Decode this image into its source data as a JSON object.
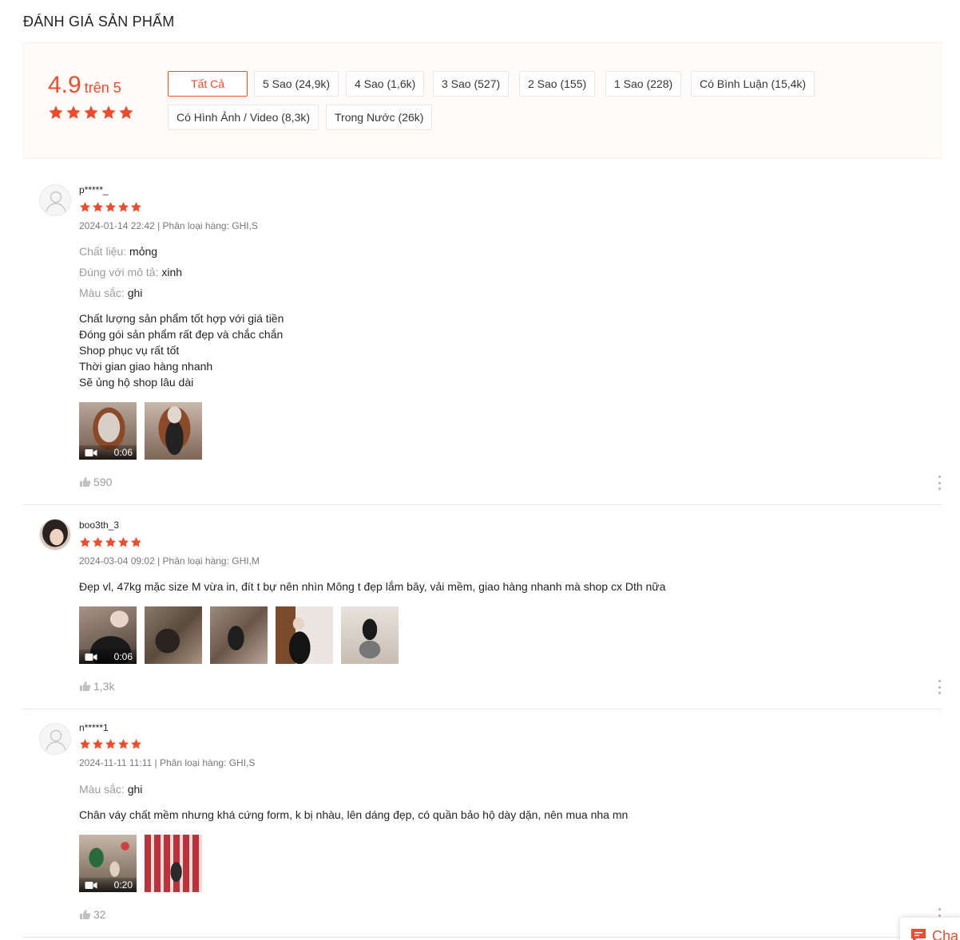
{
  "header": {
    "title": "ĐÁNH GIÁ SẢN PHẨM"
  },
  "colors": {
    "accent": "#ee4d2d",
    "overview_bg": "#fffbf8"
  },
  "overview": {
    "score": "4.9",
    "score_suffix": "trên 5",
    "stars": 5,
    "filters": [
      {
        "label": "Tất Cả",
        "active": true
      },
      {
        "label": "5 Sao (24,9k)"
      },
      {
        "label": "4 Sao (1,6k)"
      },
      {
        "label": "3 Sao (527)"
      },
      {
        "label": "2 Sao (155)"
      },
      {
        "label": "1 Sao (228)"
      },
      {
        "label": "Có Bình Luận (15,4k)"
      },
      {
        "label": "Có Hình Ảnh / Video (8,3k)"
      },
      {
        "label": "Trong Nước (26k)"
      }
    ]
  },
  "reviews": [
    {
      "user": "p*****_",
      "avatar": "default-avatar-icon",
      "rating": 5,
      "meta": "2024-01-14 22:42 | Phân loại hàng: GHI,S",
      "attributes": [
        {
          "key": "Chất liệu:",
          "value": "mỏng"
        },
        {
          "key": "Đúng với mô tả:",
          "value": "xinh"
        },
        {
          "key": "Màu sắc:",
          "value": "ghi"
        }
      ],
      "text": "Chất lượng sản phẩm tốt hợp với giá tiền\nĐóng gói sản phẩm rất đẹp và chắc chắn\nShop phục vụ rất tốt\nThời gian giao hàng nhanh\nSẽ ủng hộ shop lâu dài",
      "media": [
        {
          "type": "video",
          "duration": "0:06"
        },
        {
          "type": "image"
        }
      ],
      "likes": "590"
    },
    {
      "user": "boo3th_3",
      "avatar": "user-photo-avatar",
      "rating": 5,
      "meta": "2024-03-04 09:02 | Phân loại hàng: GHI,M",
      "attributes": [],
      "text": "Đẹp vl, 47kg mặc size M vừa in, đít t bự nên nhìn Mông t đẹp lắm bây, vải mềm, giao hàng nhanh mà shop cx Dth nữa",
      "media": [
        {
          "type": "video",
          "duration": "0:06"
        },
        {
          "type": "image"
        },
        {
          "type": "image"
        },
        {
          "type": "image"
        },
        {
          "type": "image"
        }
      ],
      "likes": "1,3k"
    },
    {
      "user": "n*****1",
      "avatar": "default-avatar-icon",
      "rating": 5,
      "meta": "2024-11-11 11:11 | Phân loại hàng: GHI,S",
      "attributes": [
        {
          "key": "Màu sắc:",
          "value": "ghi"
        }
      ],
      "text": "Chân váy chất mềm nhưng khá cứng form, k bị nhàu, lên dáng đẹp, có quần bảo hộ dày dặn, nên mua nha mn",
      "media": [
        {
          "type": "video",
          "duration": "0:20"
        },
        {
          "type": "image"
        }
      ],
      "likes": "32"
    }
  ],
  "chat": {
    "label": "Cha",
    "icon": "chat-icon"
  }
}
